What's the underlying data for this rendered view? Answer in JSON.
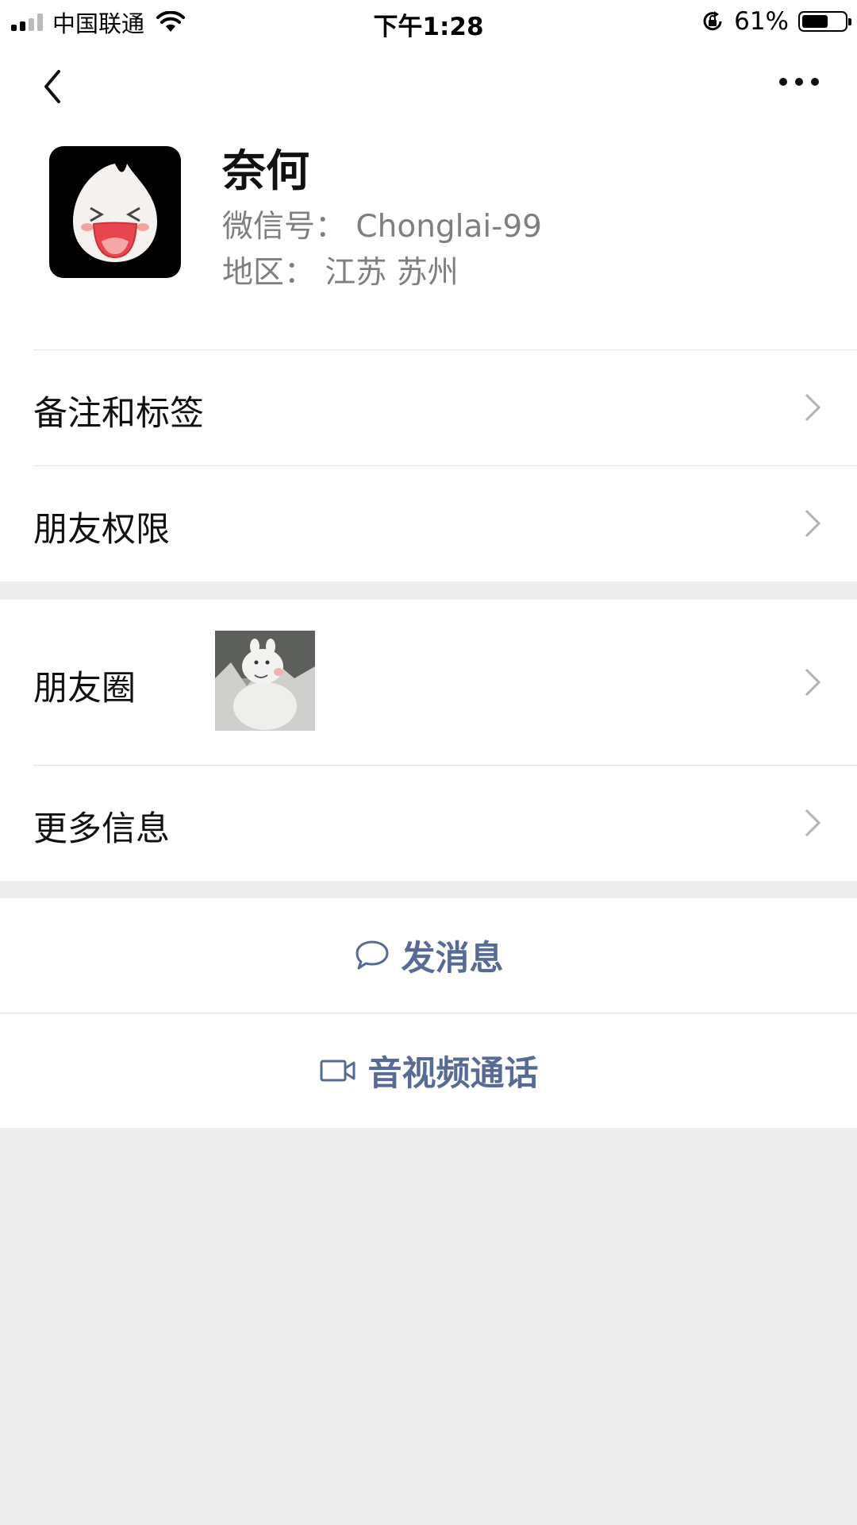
{
  "status_bar": {
    "carrier": "中国联通",
    "time": "下午1:28",
    "battery": "61%",
    "battery_level": 0.61,
    "signal_bars": 2
  },
  "nav": {
    "back_icon": "chevron-left-icon",
    "more_icon": "more-dots-icon"
  },
  "profile": {
    "name": "奈何",
    "wechat_id": "微信号： Chonglai-99",
    "region": "地区： 江苏 苏州",
    "avatar_icon": "laughing-face-icon"
  },
  "menu": {
    "remark_tags": "备注和标签",
    "friend_permissions": "朋友权限",
    "moments": "朋友圈",
    "more_info": "更多信息"
  },
  "actions": {
    "send_message": "发消息",
    "av_call": "音视频通话"
  },
  "colors": {
    "link": "#576b95",
    "background": "#ededed",
    "secondary_text": "#7f7f7f"
  }
}
